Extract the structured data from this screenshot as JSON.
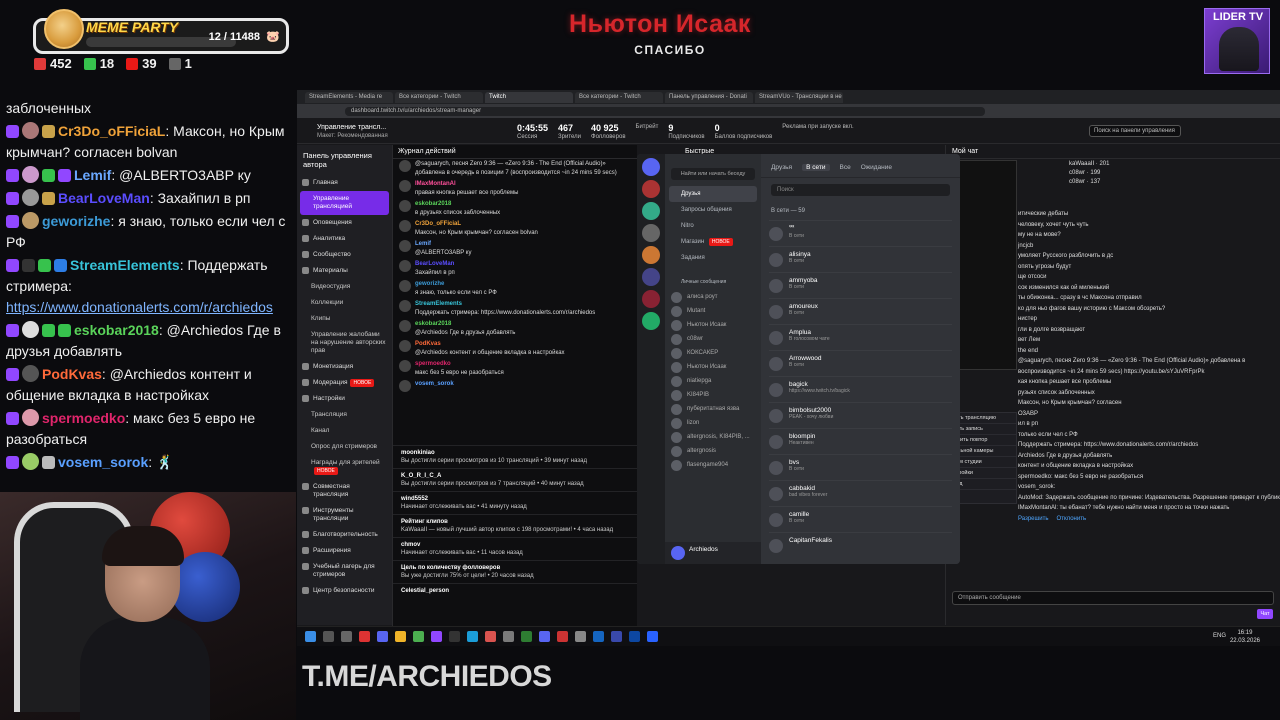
{
  "overlay": {
    "meme_title": "MEME PARTY",
    "meme_count": "12 / 11488",
    "stats": [
      {
        "icon": "donation-icon",
        "value": "452",
        "color": "#e03a3a"
      },
      {
        "icon": "kill-icon",
        "value": "18",
        "color": "#37c24d"
      },
      {
        "icon": "live-icon",
        "value": "39",
        "color": "#e91916"
      },
      {
        "icon": "weapon-icon",
        "value": "1",
        "color": "#cccccc"
      }
    ],
    "donor_name": "Ньютон Исаак",
    "donor_sub": "СПАСИБО",
    "lider_title": "LIDER TV",
    "tme": "T.ME/ARCHIEDOS"
  },
  "chat": [
    {
      "user": "",
      "color": "#ffffff",
      "text": "заблоченных"
    },
    {
      "user": "Cr3Do_oFFiciaL",
      "color": "#f0a33a",
      "text": ": Максон, но Крым крымчан? согласен bolvan"
    },
    {
      "user": "Lemif",
      "color": "#6aa8ff",
      "text": ": @ALBERTO3ABP ку"
    },
    {
      "user": "BearLoveMan",
      "color": "#5b4dff",
      "text": ": Захайпил в рп"
    },
    {
      "user": "geworizhe",
      "color": "#3c9ad6",
      "text": ": я знаю, только если чел с РФ"
    },
    {
      "user": "StreamElements",
      "color": "#38c4d9",
      "text": ": Поддержать стримера: ",
      "link": "https://www.donationalerts.com/r/archiedos"
    },
    {
      "user": "eskobar2018",
      "color": "#5ad35a",
      "text": ": @Archiedos Где в друзья добавлять"
    },
    {
      "user": "PodKvas",
      "color": "#ff6a3a",
      "text": ": @Archiedos контент и общение вкладка в настройках"
    },
    {
      "user": "spermoedko",
      "color": "#e0256b",
      "text": ": макс без 5 евро не разобраться"
    },
    {
      "user": "vosem_sorok",
      "color": "#5aa0ff",
      "text": ":"
    }
  ],
  "browser": {
    "tabs": [
      "StreamElements - Media re",
      "Все категории - Twitch",
      "Twitch",
      "Все категории - Twitch",
      "Панель управления - Donati",
      "StreamVUo - Трансляции в не"
    ],
    "url": "dashboard.twitch.tv/u/archiedos/stream-manager"
  },
  "twitch": {
    "title": "Управление трансл...",
    "subtitle": "Макет: Рекомендованная",
    "stats": [
      {
        "value": "0:45:55",
        "label": "Сессия"
      },
      {
        "value": "467",
        "label": "Зрители"
      },
      {
        "value": "40 925",
        "label": "Фолловеров"
      },
      {
        "value": "",
        "label": "Битрейт"
      },
      {
        "value": "9",
        "label": "Подписчиков"
      },
      {
        "value": "0",
        "label": "Баллов подписчиков"
      },
      {
        "value": "",
        "label": "Реклама при запуске вкл."
      }
    ],
    "search_placeholder": "Поиск на панели управления",
    "nav_head": "Панель управления автора",
    "nav": [
      {
        "label": "Главная",
        "type": "item"
      },
      {
        "label": "Управление трансляцией",
        "type": "active"
      },
      {
        "label": "Оповещения",
        "type": "item"
      },
      {
        "label": "Аналитика",
        "type": "item"
      },
      {
        "label": "Сообщество",
        "type": "item"
      },
      {
        "label": "Материалы",
        "type": "item"
      },
      {
        "label": "Видеостудия",
        "type": "sub"
      },
      {
        "label": "Коллекции",
        "type": "sub"
      },
      {
        "label": "Клипы",
        "type": "sub"
      },
      {
        "label": "Управление жалобами на нарушение авторских прав",
        "type": "sub"
      },
      {
        "label": "Монетизация",
        "type": "item"
      },
      {
        "label": "Модерация",
        "type": "item",
        "badge": "НОВОЕ"
      },
      {
        "label": "Настройки",
        "type": "item"
      },
      {
        "label": "Трансляция",
        "type": "sub"
      },
      {
        "label": "Канал",
        "type": "sub"
      },
      {
        "label": "Опрос для стримеров",
        "type": "sub"
      },
      {
        "label": "Награды для зрителей",
        "type": "sub",
        "badge": "НОВОЕ"
      },
      {
        "label": "Совместная трансляция",
        "type": "item"
      },
      {
        "label": "Инструменты трансляции",
        "type": "item"
      },
      {
        "label": "Благотворительность",
        "type": "item"
      },
      {
        "label": "Расширения",
        "type": "item"
      },
      {
        "label": "Учебный лагерь для стримеров",
        "type": "item"
      },
      {
        "label": "Центр безопасности",
        "type": "item"
      }
    ],
    "actlog_head": "Журнал действий",
    "actlog": [
      {
        "user": "",
        "text": "@saguarych, песня Zero 9:36 — «Zero 9:36 - The End (Official Audio)» добавлена в очередь в позиции 7 (воспроизводится ~in 24 mins 59 secs)"
      },
      {
        "user": "IMaxMontanAl",
        "text": "правая кнопка решает все проблемы"
      },
      {
        "user": "eskobar2018",
        "text": "в друзьях список заблоченных"
      },
      {
        "user": "Cr3Do_oFFiciaL",
        "text": "Максон, но Крым крымчан? согласен bolvan"
      },
      {
        "user": "Lemif",
        "text": "@ALBERTO3ABP ку"
      },
      {
        "user": "BearLoveMan",
        "text": "Захайпил в рп"
      },
      {
        "user": "geworizhe",
        "text": "я знаю, только если чел с РФ"
      },
      {
        "user": "StreamElements",
        "text": "Поддержать стримера: https://www.donationalerts.com/r/archiedos"
      },
      {
        "user": "eskobar2018",
        "text": "@Archiedos Где в друзья добавлять"
      },
      {
        "user": "PodKvas",
        "text": "@Archiedos контент и общение вкладка в настройках"
      },
      {
        "user": "spermoedko",
        "text": "макс без 5 евро не разобраться"
      },
      {
        "user": "vosem_sorok",
        "text": ""
      }
    ],
    "events": [
      {
        "user": "moonkiniao",
        "text": "Вы достигли серии просмотров из 10 трансляций • 39 минут назад"
      },
      {
        "user": "K_O_R_I_C_A",
        "text": "Вы достигли серии просмотров из 7 трансляций • 40 минут назад"
      },
      {
        "user": "wind5552",
        "text": "Начинает отслеживать вас • 41 минуту назад"
      },
      {
        "user": "Рейтинг клипов",
        "text": "KaWaaaII — новый лучший автор клипов с 198 просмотрами! • 4 часа назад"
      },
      {
        "user": "chmov",
        "text": "Начинает отслеживать вас • 11 часов назад"
      },
      {
        "user": "Цель по количеству фолловеров",
        "text": "Вы уже достигли 75% от цели! • 20 часов назад"
      },
      {
        "user": "Celestial_person",
        "text": ""
      }
    ],
    "quick_head": "Быстрые действия"
  },
  "discord": {
    "find": "Найти или начать беседу",
    "nav": [
      "Друзья",
      "Запросы общения",
      "Nitro",
      "Магазин",
      "Задания"
    ],
    "shop_badge": "НОВОЕ",
    "dm_head": "Личные сообщения",
    "dms": [
      "алиса роут",
      "Mutant",
      "Ньютон Исаак",
      "c08wr",
      "КОКСАКЕР",
      "Ньютон Исаак",
      "niatiepga",
      "KI84PIB",
      "пуберитатная язва",
      "lizon",
      "altergnosis, KI84PIB, ...",
      "altergnosis",
      "flasengame904"
    ],
    "tabs": [
      "Друзья",
      "В сети",
      "Все",
      "Ожидание"
    ],
    "search": "Поиск",
    "online_count": "В сети — 59",
    "friends": [
      {
        "name": "ᓫᓫᓫ",
        "status": "В сети"
      },
      {
        "name": "alisinya",
        "status": "В сети"
      },
      {
        "name": "ammyoba",
        "status": "В сети"
      },
      {
        "name": "amoureux",
        "status": "В сети"
      },
      {
        "name": "Amplua",
        "status": "В голосовом чате"
      },
      {
        "name": "Arrowwood",
        "status": "В сети"
      },
      {
        "name": "bagick",
        "status": "https://www.twitch.tv/bagick"
      },
      {
        "name": "bimbolsut2000",
        "status": "PEAK - хочу любви"
      },
      {
        "name": "bloompin",
        "status": "Неактивен"
      },
      {
        "name": "bvs",
        "status": "В сети"
      },
      {
        "name": "cabbakid",
        "status": "bad vibes forever"
      },
      {
        "name": "camille",
        "status": "В сети"
      },
      {
        "name": "CapitanFekalis",
        "status": ""
      }
    ],
    "user": "Archiedos"
  },
  "obs_menu": [
    "новить трансляцию",
    "Начать запись",
    "апустить повтор",
    "ртуальной камеры",
    "Режим студии",
    "Настройки",
    "Выход"
  ],
  "right_chat": {
    "head": "Мой чат",
    "lines": [
      {
        "text": "итические дебаты"
      },
      {
        "text": "человеку, хочет чуть чуть"
      },
      {
        "text": "му не на мове?"
      },
      {
        "text": "jncjcb"
      },
      {
        "text": "умоляет Русского разблочить в дс"
      },
      {
        "text": "опять угрозы будут"
      },
      {
        "text": "ще отсоси"
      },
      {
        "text": "сок изменился как ой миленький"
      },
      {
        "text": "ты обижонка... сразу в чс Максона отправил"
      },
      {
        "text": "ко для ньо фагов вашу историю с Максом обозреть?"
      },
      {
        "text": "нистер"
      },
      {
        "text": "гли в долге возвращают"
      },
      {
        "text": "вет Лем"
      },
      {
        "text": "the end"
      },
      {
        "text": "@saguarych, песня Zero 9:36 — «Zero 9:36 - The End (Official Audio)» добавлена в"
      },
      {
        "text": "воспроизводится ~in 24 mins 59 secs) https://youtu.be/sYJuVRFprPk"
      },
      {
        "text": "кая кнопка решает все проблемы"
      },
      {
        "text": "рузьях список заблоченных"
      },
      {
        "text": "Максон, но Крым крымчан? согласен"
      },
      {
        "text": "O3ABP"
      },
      {
        "text": "ил в рп"
      },
      {
        "text": "только если чел с РФ"
      },
      {
        "text": "Поддержать стримера: https://www.donationalerts.com/r/archiedos"
      },
      {
        "text": "Archiedos Где в друзья добавлять"
      },
      {
        "text": "контент и общение вкладка в настройках"
      },
      {
        "text": "spermoedko: макс без 5 евро не разобраться"
      },
      {
        "text": "vosem_sorok:"
      },
      {
        "text": "AutoMod: Задержать сообщение по причине: Издевательства. Разрешение приведет к публикации в чате."
      },
      {
        "text": "IMaxMontanAl: ты ебанат? тебе нужно найти меня и просто на точки нажать"
      }
    ],
    "automod_allow": "Разрешить",
    "automod_deny": "Отклонить",
    "input_placeholder": "Отправить сообщение",
    "chat_btn": "Чат",
    "leaders": [
      {
        "name": "kaWaaaII",
        "value": "201"
      },
      {
        "name": "c08wr",
        "value": "199"
      },
      {
        "name": "c08wr",
        "value": "137"
      }
    ]
  },
  "taskbar": {
    "lang": "ENG",
    "time": "16:19",
    "date": "22.03.2026"
  }
}
